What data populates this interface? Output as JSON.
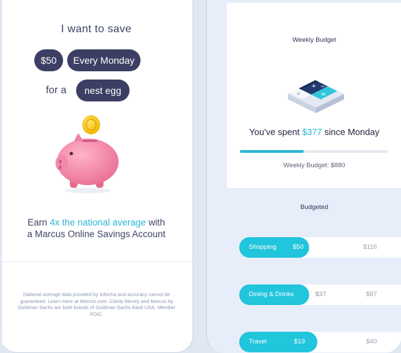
{
  "save_screen": {
    "heading": "I want to save",
    "amount": "$50",
    "frequency": "Every Monday",
    "for_a": "for a",
    "goal": "nest egg",
    "earn_prefix": "Earn ",
    "earn_highlight": "4x the national average",
    "earn_suffix": " with",
    "earn_line2": "a Marcus Online Savings Account",
    "disclaimer": "National average data provided by Informa and accuracy cannot be guaranteed. Learn more at Marcus.com. Clarity Money and Marcus by Goldman Sachs are both brands of Goldman Sachs Bank USA. Member FDIC."
  },
  "budget_screen": {
    "weekly_title": "Weekly Budget",
    "spent_prefix": "You've spent ",
    "spent_amount": "$377",
    "spent_suffix": " since Monday",
    "progress_fraction": 0.43,
    "budget_total": "Weekly Budget: $880",
    "budgeted_title": "Budgeted",
    "categories": [
      {
        "name": "Shopping",
        "spent": "$50",
        "budget": "$116",
        "fraction": 0.43
      },
      {
        "name": "Dining & Drinks",
        "spent": "$37",
        "budget": "$87",
        "fraction": 0.43
      },
      {
        "name": "Travel",
        "spent": "$19",
        "budget": "$40",
        "fraction": 0.48
      }
    ]
  },
  "colors": {
    "accent": "#2bb6d7",
    "bar": "#21c5dc",
    "pill": "#3c3f63"
  }
}
